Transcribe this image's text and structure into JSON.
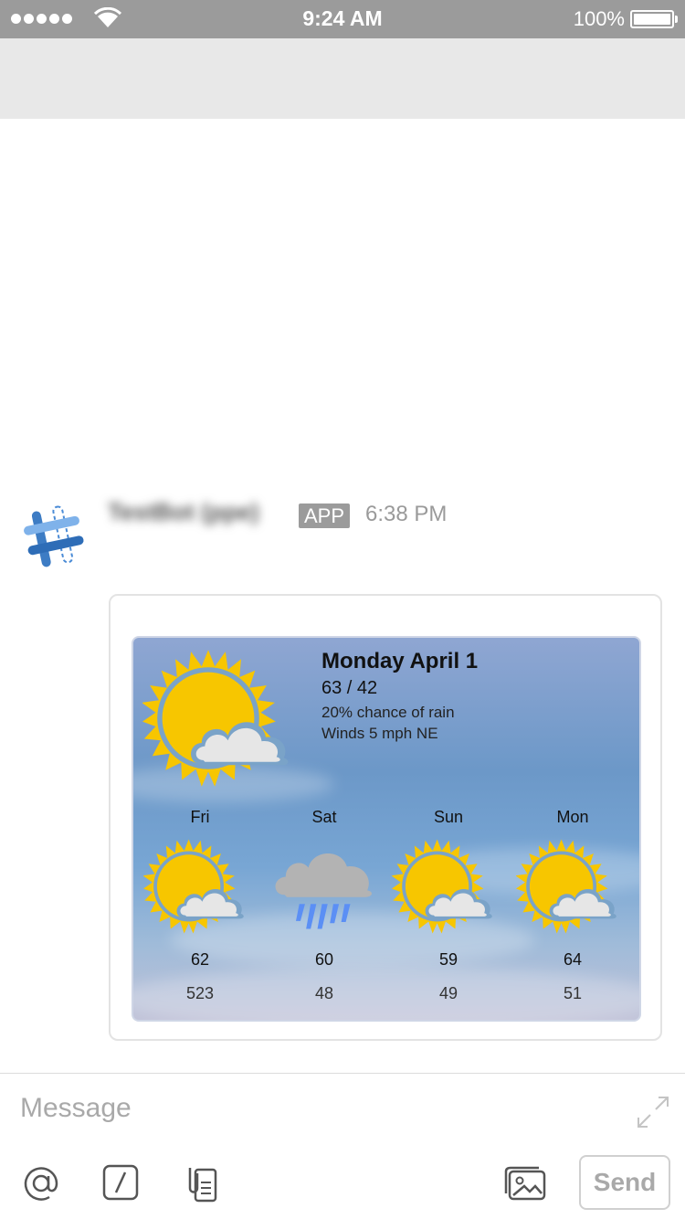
{
  "status_bar": {
    "time": "9:24 AM",
    "battery": "100%"
  },
  "message": {
    "sender": "TestBot (ppe)",
    "badge": "APP",
    "time": "6:38 PM"
  },
  "weather": {
    "today": {
      "title": "Monday April 1",
      "temps": "63 / 42",
      "rain": "20% chance of rain",
      "wind": "Winds 5 mph NE",
      "icon": "partly-cloudy-icon"
    },
    "forecast": [
      {
        "day": "Fri",
        "high": "62",
        "low": "523",
        "icon": "partly-cloudy-icon"
      },
      {
        "day": "Sat",
        "high": "60",
        "low": "48",
        "icon": "rain-icon"
      },
      {
        "day": "Sun",
        "high": "59",
        "low": "49",
        "icon": "partly-cloudy-icon"
      },
      {
        "day": "Mon",
        "high": "64",
        "low": "51",
        "icon": "partly-cloudy-icon"
      }
    ]
  },
  "composer": {
    "placeholder": "Message",
    "send_label": "Send"
  },
  "colors": {
    "sun": "#f7c600",
    "sun_ring": "#7aa3c8",
    "cloud": "#e6e6e6",
    "rain_cloud": "#b3b3b3",
    "rain": "#5b8ff5",
    "status_bar": "#9b9b9b"
  }
}
